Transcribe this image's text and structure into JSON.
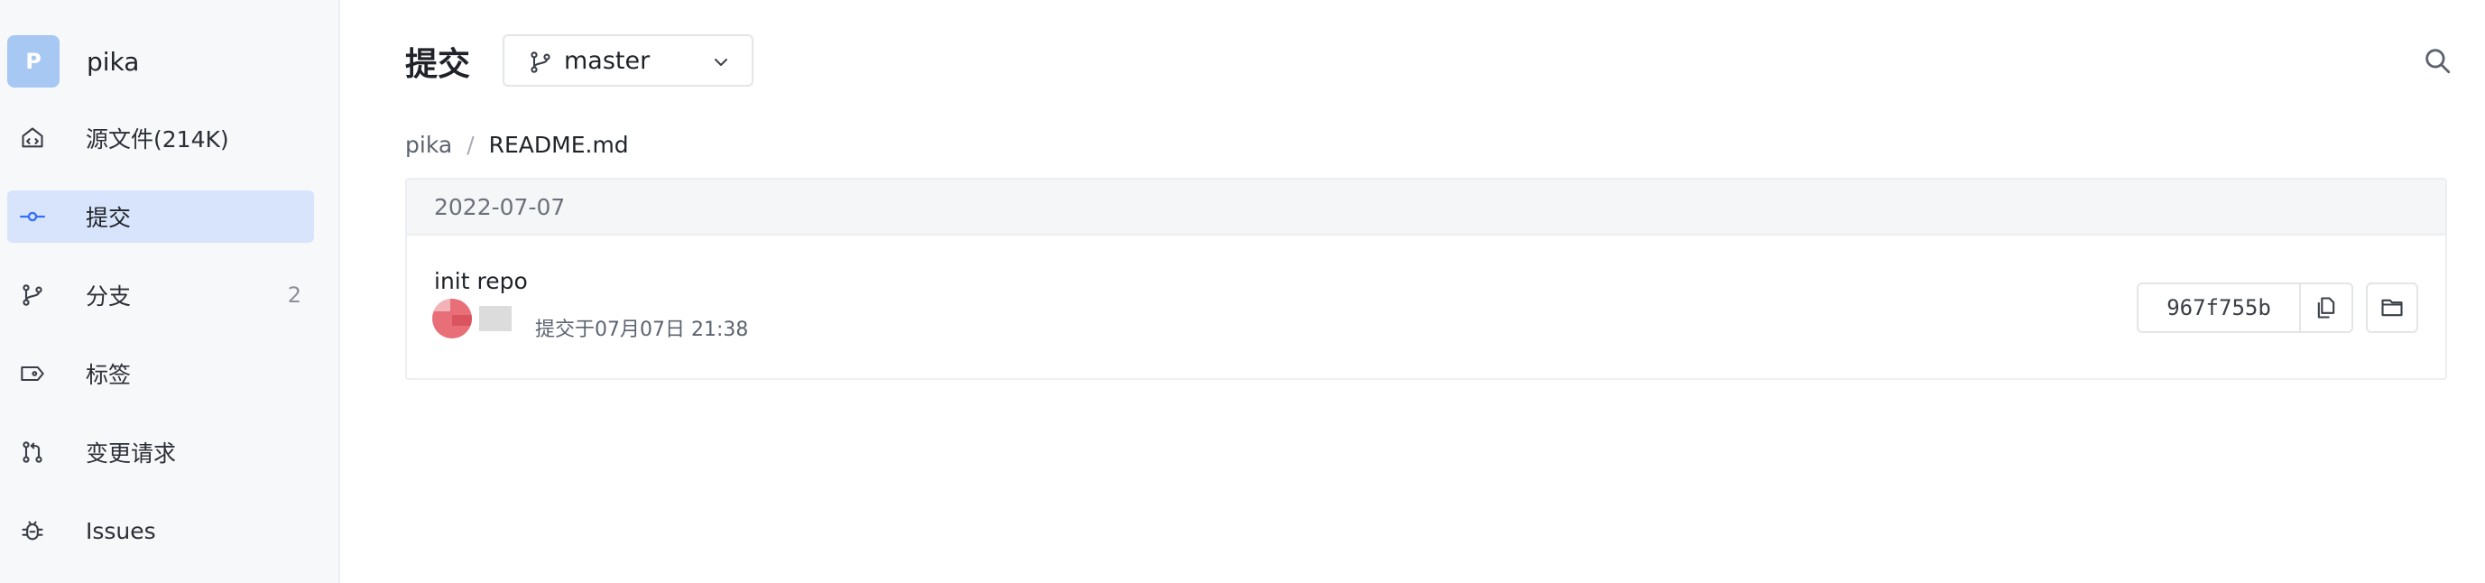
{
  "repo": {
    "avatar_letter": "P",
    "name": "pika",
    "avatar_color": "#a6c8f3"
  },
  "sidebar": {
    "items": [
      {
        "label": "源文件(214K)",
        "icon": "code-file-icon",
        "count": ""
      },
      {
        "label": "提交",
        "icon": "commit-icon",
        "count": "",
        "active": true
      },
      {
        "label": "分支",
        "icon": "branch-icon",
        "count": "2"
      },
      {
        "label": "标签",
        "icon": "tag-icon",
        "count": ""
      },
      {
        "label": "变更请求",
        "icon": "pull-request-icon",
        "count": ""
      },
      {
        "label": "Issues",
        "icon": "bug-icon",
        "count": ""
      }
    ]
  },
  "header": {
    "title": "提交",
    "branch": "master"
  },
  "breadcrumb": {
    "root": "pika",
    "separator": "/",
    "current": "README.md"
  },
  "commits": {
    "date": "2022-07-07",
    "items": [
      {
        "message": "init repo",
        "meta": "提交于07月07日 21:38",
        "sha": "967f755b"
      }
    ]
  },
  "colors": {
    "accent": "#3370ff",
    "active_bg": "#d8e4fb",
    "sidebar_bg": "#f7f8fa"
  }
}
